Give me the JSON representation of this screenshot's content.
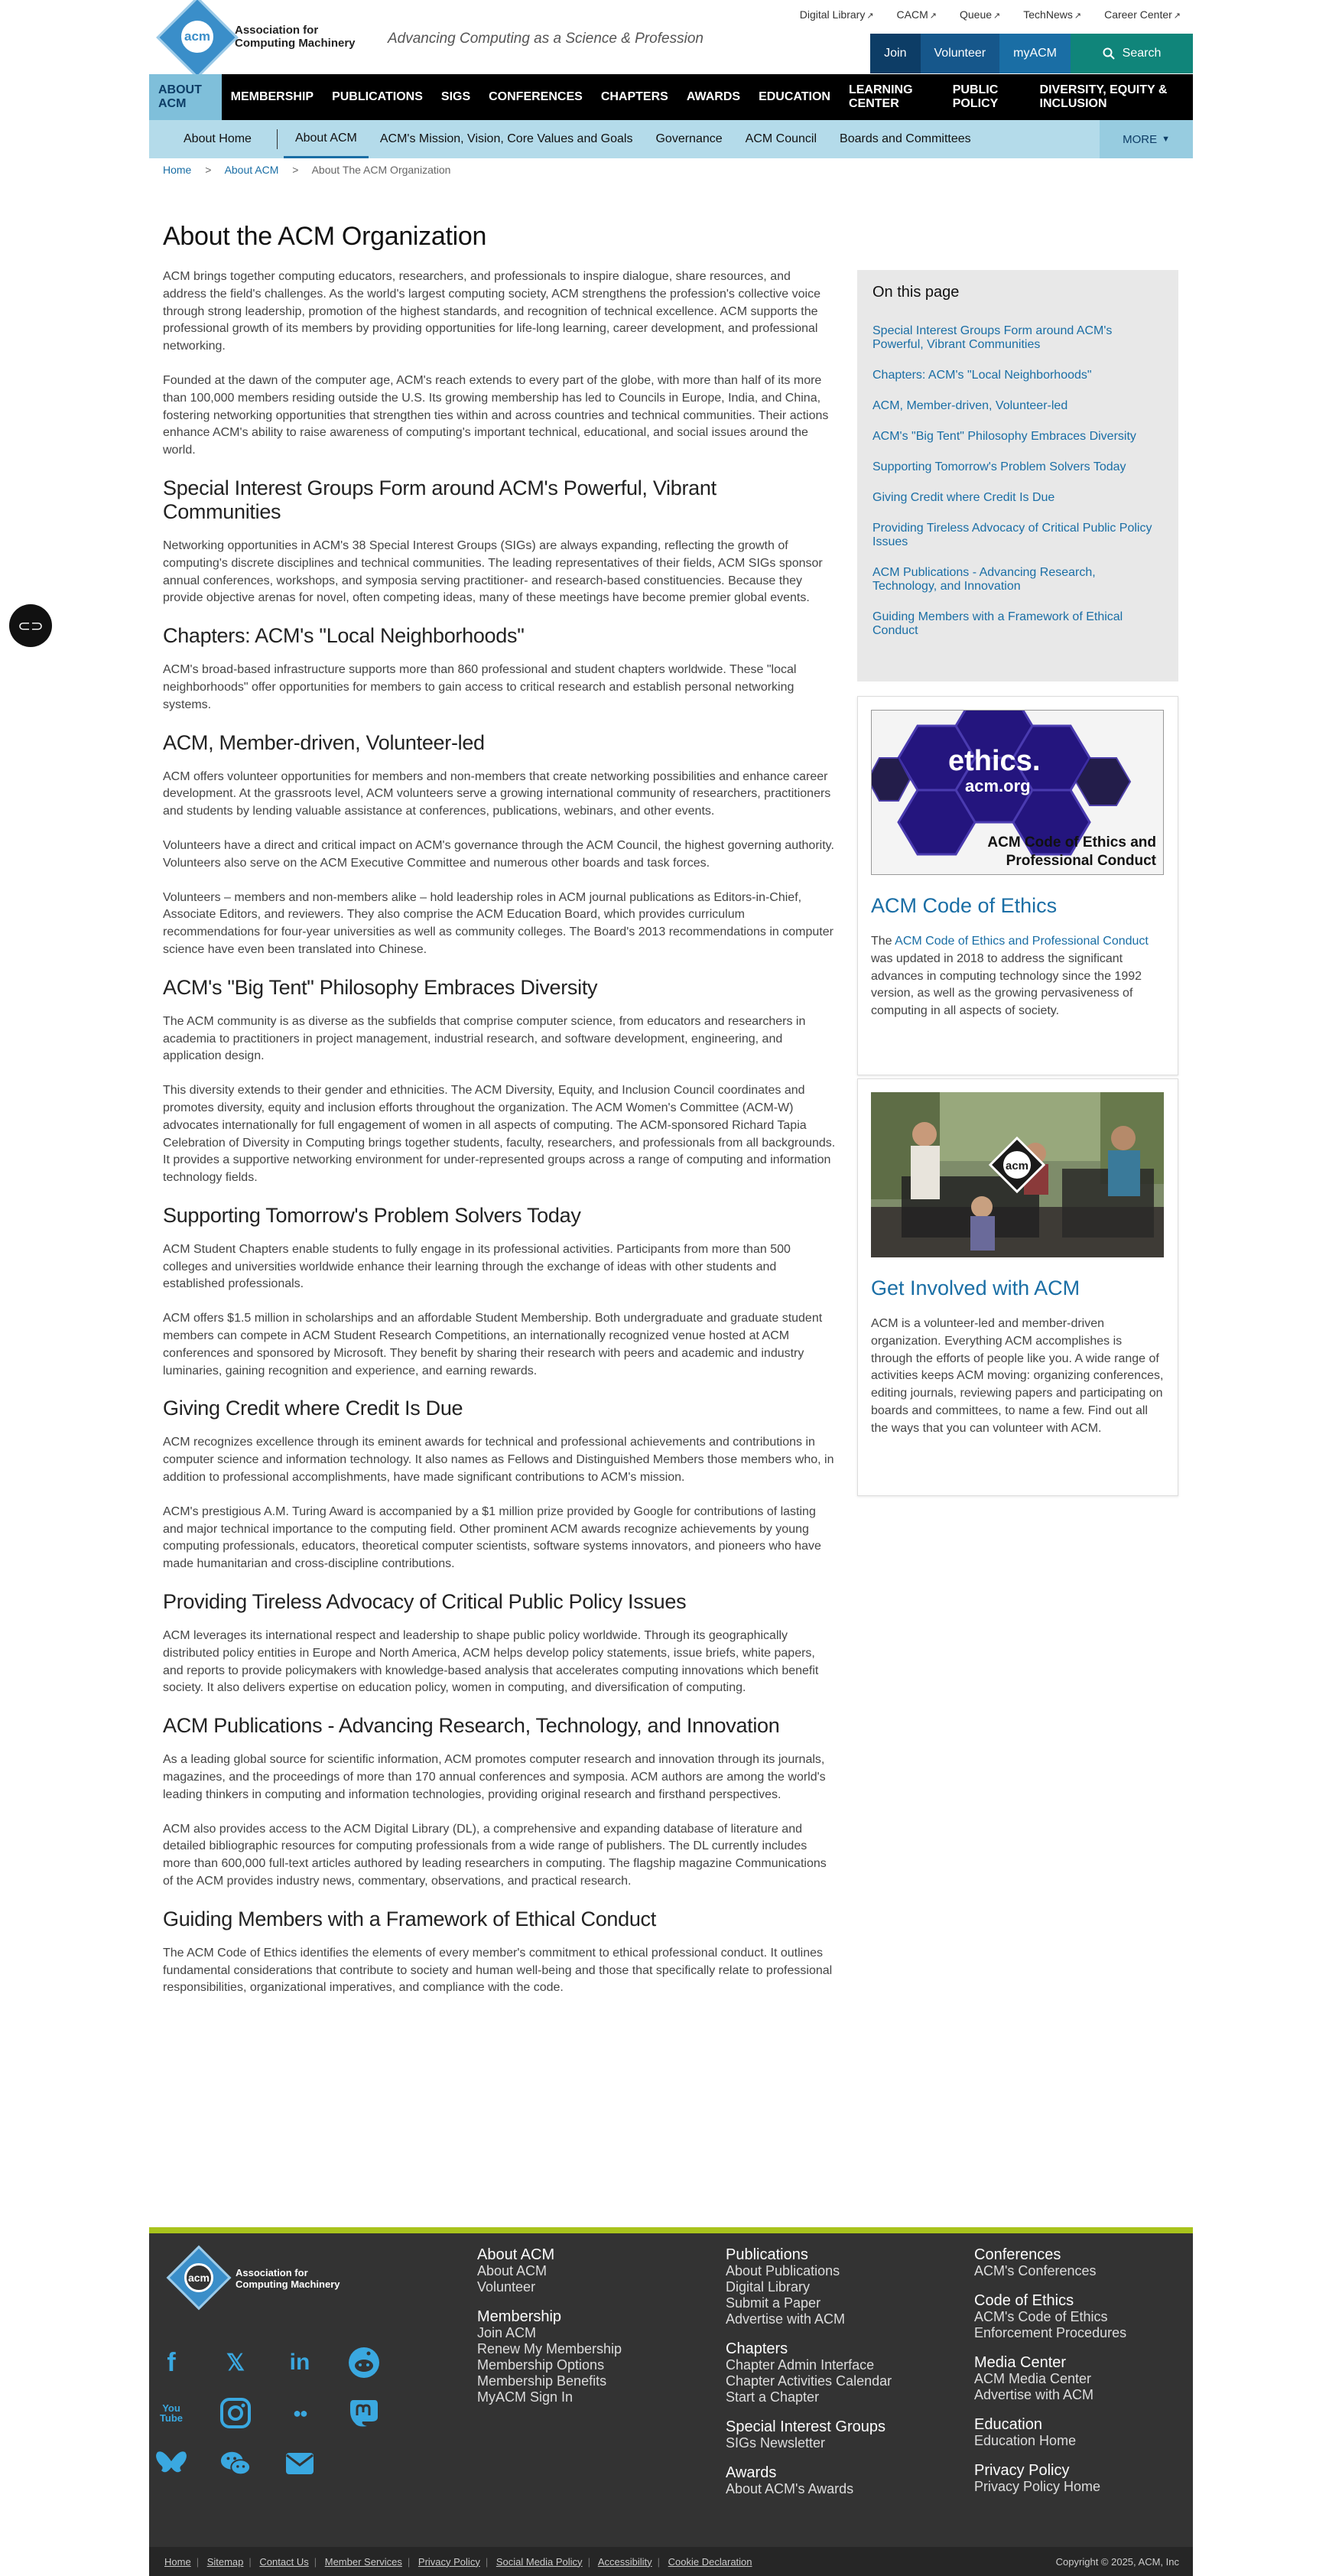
{
  "header": {
    "logo_line1": "Association for",
    "logo_line2": "Computing Machinery",
    "logo_mark": "acm",
    "tagline": "Advancing Computing as a Science & Profession",
    "top_links": [
      "Digital Library",
      "CACM",
      "Queue",
      "TechNews",
      "Career Center"
    ],
    "actions": {
      "join": "Join",
      "volunteer": "Volunteer",
      "myacm": "myACM",
      "search": "Search"
    }
  },
  "nav": {
    "main": [
      "ABOUT ACM",
      "MEMBERSHIP",
      "PUBLICATIONS",
      "SIGS",
      "CONFERENCES",
      "CHAPTERS",
      "AWARDS",
      "EDUCATION",
      "LEARNING CENTER",
      "PUBLIC POLICY",
      "DIVERSITY, EQUITY & INCLUSION"
    ],
    "sub": [
      "About Home",
      "About ACM",
      "ACM's Mission, Vision, Core Values and Goals",
      "Governance",
      "ACM Council",
      "Boards and Committees"
    ],
    "more": "MORE"
  },
  "breadcrumb": {
    "home": "Home",
    "about": "About ACM",
    "current": "About The ACM Organization",
    "sep": ">"
  },
  "main": {
    "title": "About the ACM Organization",
    "intro": [
      "ACM brings together computing educators, researchers, and professionals to inspire dialogue, share resources, and address the field's challenges. As the world's largest computing society, ACM strengthens the profession's collective voice through strong leadership, promotion of the highest standards, and recognition of technical excellence. ACM supports the professional growth of its members by providing opportunities for life-long learning, career development, and professional networking.",
      "Founded at the dawn of the computer age, ACM's reach extends to every part of the globe, with more than half of its more than 100,000 members residing outside the U.S.  Its growing membership has led to Councils in Europe, India, and China, fostering networking opportunities that strengthen ties within and across countries and technical communities.  Their actions enhance ACM's ability to raise awareness of computing's important technical, educational, and social issues around the world."
    ],
    "sections": [
      {
        "heading": "Special Interest Groups Form around ACM's Powerful, Vibrant Communities",
        "paragraphs": [
          "Networking opportunities in ACM's 38 Special Interest Groups (SIGs) are always expanding, reflecting the growth of computing's discrete disciplines and technical communities. The leading representatives of their fields, ACM SIGs sponsor annual conferences, workshops, and symposia serving practitioner- and research-based constituencies. Because they provide objective arenas for novel, often competing ideas, many of these meetings have become premier global events."
        ]
      },
      {
        "heading": "Chapters: ACM's \"Local Neighborhoods\"",
        "paragraphs": [
          "ACM's broad-based infrastructure supports more than 860 professional and student chapters worldwide. These \"local neighborhoods\" offer opportunities for members to gain access to critical research and establish personal networking systems."
        ]
      },
      {
        "heading": "ACM, Member-driven, Volunteer-led",
        "paragraphs": [
          "ACM offers volunteer opportunities for members and non-members that create networking possibilities and enhance career development.  At the grassroots level, ACM volunteers serve a growing international community of researchers, practitioners and students by lending valuable assistance at conferences, publications, webinars, and other events.",
          "Volunteers have a direct and critical impact on ACM's governance through the ACM Council, the highest governing authority.  Volunteers also serve on the ACM Executive Committee and numerous other boards and task forces.",
          "Volunteers – members and non-members alike – hold leadership roles in ACM journal publications as Editors-in-Chief, Associate Editors, and reviewers.  They also comprise the ACM Education Board, which provides curriculum recommendations for four-year universities as well as community colleges. The Board's 2013 recommendations in computer science have even been translated into Chinese."
        ]
      },
      {
        "heading": "ACM's \"Big Tent\" Philosophy Embraces Diversity",
        "paragraphs": [
          "The ACM community is as diverse as the subfields that comprise computer science, from educators and researchers in academia to practitioners in project management, industrial research, and software development, engineering, and application design.",
          "This diversity extends to their gender and ethnicities. The ACM Diversity, Equity, and Inclusion Council coordinates and promotes diversity, equity and inclusion efforts throughout the organization. The ACM Women's Committee (ACM-W) advocates internationally for full engagement of women in all aspects of computing. The ACM-sponsored Richard Tapia Celebration of Diversity in Computing brings together students, faculty, researchers, and professionals from all backgrounds.  It provides a supportive networking environment for under-represented groups across a range of computing and information technology fields."
        ]
      },
      {
        "heading": "Supporting Tomorrow's Problem Solvers Today",
        "paragraphs": [
          "ACM Student Chapters enable students to fully engage in its professional activities. Participants from more than 500 colleges and universities worldwide enhance their learning through the exchange of ideas with other students and established professionals.",
          "ACM offers $1.5 million in scholarships and an affordable Student Membership.  Both undergraduate and graduate student members can compete in ACM Student Research Competitions, an internationally recognized venue hosted at ACM conferences and sponsored by Microsoft.  They benefit by sharing their research with peers and academic and industry luminaries, gaining recognition and experience, and earning rewards."
        ]
      },
      {
        "heading": "Giving Credit where Credit Is Due",
        "paragraphs": [
          "ACM recognizes excellence through its eminent awards for technical and professional achievements and contributions in computer science and information technology. It also names as Fellows and Distinguished Members those members who, in addition to professional accomplishments, have made significant contributions to ACM's mission.",
          "ACM's prestigious A.M. Turing Award is accompanied by a $1 million prize provided by Google for contributions of lasting and major technical importance to the computing field.  Other prominent ACM awards recognize achievements by young computing professionals, educators, theoretical computer scientists, software systems innovators, and pioneers who have made humanitarian and cross-discipline contributions."
        ]
      },
      {
        "heading": "Providing Tireless Advocacy of Critical Public Policy Issues",
        "paragraphs": [
          "ACM leverages its international respect and leadership to shape public policy worldwide. Through its geographically distributed policy entities in Europe and North America, ACM helps develop policy statements, issue briefs, white papers, and reports to provide policymakers with knowledge-based analysis that accelerates computing innovations which benefit society.   It also delivers expertise on education policy, women in computing, and diversification of computing."
        ]
      },
      {
        "heading": "ACM Publications - Advancing Research, Technology, and Innovation",
        "paragraphs": [
          "As a leading global source for scientific information, ACM promotes computer research and innovation through its journals, magazines, and the proceedings of more than 170 annual conferences and symposia.  ACM authors are among the world's leading thinkers in computing and information technologies, providing original research and firsthand perspectives.",
          "ACM also provides access to the ACM Digital Library (DL), a comprehensive and expanding database of literature and detailed bibliographic resources for computing professionals from a wide range of publishers. The DL currently includes more than 600,000 full-text articles authored by leading researchers in computing. The flagship magazine Communications of the ACM provides industry news, commentary, observations, and practical research."
        ]
      },
      {
        "heading": "Guiding Members with a Framework of Ethical Conduct",
        "paragraphs": [
          "The ACM Code of Ethics identifies the elements of every member's commitment to ethical professional conduct.  It outlines fundamental considerations that contribute to society and human well-being and those that specifically relate to professional responsibilities, organizational imperatives, and compliance with the code."
        ]
      }
    ]
  },
  "sidebar": {
    "toc_title": "On this page",
    "toc": [
      "Special Interest Groups Form around ACM's Powerful, Vibrant Communities",
      "Chapters: ACM's \"Local Neighborhoods\"",
      "ACM, Member-driven, Volunteer-led",
      "ACM's \"Big Tent\" Philosophy Embraces Diversity",
      "Supporting Tomorrow's Problem Solvers Today",
      "Giving Credit where Credit Is Due",
      "Providing Tireless Advocacy of Critical Public Policy Issues",
      "ACM Publications - Advancing Research, Technology, and Innovation",
      "Guiding Members with a Framework of Ethical Conduct"
    ],
    "ethics": {
      "img_word": "ethics.",
      "img_domain": "acm.org",
      "img_caption1": "ACM Code of Ethics and",
      "img_caption2": "Professional Conduct",
      "title": "ACM Code of Ethics",
      "text_prefix": "The ",
      "link": "ACM Code of Ethics and Professional Conduct",
      "text_suffix": " was updated in 2018 to address the significant advances in computing technology since the 1992 version, as well as the growing pervasiveness of computing in all aspects of society."
    },
    "involved": {
      "badge": "acm",
      "title": "Get Involved with ACM",
      "text": "ACM is a volunteer-led and member-driven organization. Everything ACM accomplishes is through the efforts of people like you. A wide range of activities keeps ACM moving: organizing conferences, editing journals, reviewing papers and participating on boards and committees, to name a few. Find out all the ways that you can volunteer with ACM."
    }
  },
  "footer": {
    "logo_line1": "Association for",
    "logo_line2": "Computing Machinery",
    "logo_mark": "acm",
    "socials": [
      "facebook-icon",
      "x-icon",
      "linkedin-icon",
      "reddit-icon",
      "youtube-icon",
      "instagram-icon",
      "flickr-icon",
      "mastodon-icon",
      "bluesky-icon",
      "wechat-icon",
      "email-icon"
    ],
    "social_glyphs": {
      "fb": "f",
      "x": "𝕏",
      "in": "in",
      "yt": "You\nTube",
      "fl": "●●"
    },
    "col1": {
      "h1": "About ACM",
      "l1": [
        "About ACM",
        "Volunteer"
      ],
      "h2": "Membership",
      "l2": [
        "Join ACM",
        "Renew My Membership",
        "Membership Options",
        "Membership Benefits",
        "MyACM Sign In"
      ]
    },
    "col2": {
      "h1": "Publications",
      "l1": [
        "About Publications",
        "Digital Library",
        "Submit a Paper",
        "Advertise with ACM"
      ],
      "h2": "Chapters",
      "l2": [
        "Chapter Admin Interface",
        "Chapter Activities Calendar",
        "Start a Chapter"
      ],
      "h3": "Special Interest Groups",
      "l3": [
        "SIGs Newsletter"
      ],
      "h4": "Awards",
      "l4": [
        "About ACM's Awards"
      ]
    },
    "col3": {
      "h1": "Conferences",
      "l1": [
        "ACM's Conferences"
      ],
      "h2": "Code of Ethics",
      "l2": [
        "ACM's Code of Ethics",
        "Enforcement Procedures"
      ],
      "h3": "Media Center",
      "l3": [
        "ACM Media Center",
        "Advertise with ACM"
      ],
      "h4": "Education",
      "l4": [
        "Education Home"
      ],
      "h5": "Privacy Policy",
      "l5": [
        "Privacy Policy Home"
      ]
    },
    "bottom_links": [
      "Home",
      "Sitemap",
      "Contact Us",
      "Member Services",
      "Privacy Policy",
      "Social Media Policy",
      "Accessibility",
      "Cookie Declaration"
    ],
    "copyright": "Copyright © 2025, ACM, Inc"
  },
  "colors": {
    "link": "#1a6ea5",
    "nav_bg": "#000000",
    "subnav_bg": "#b4dbea",
    "footer_bg": "#333333",
    "accent_green": "#a9c31c",
    "search_btn": "#10857a"
  }
}
